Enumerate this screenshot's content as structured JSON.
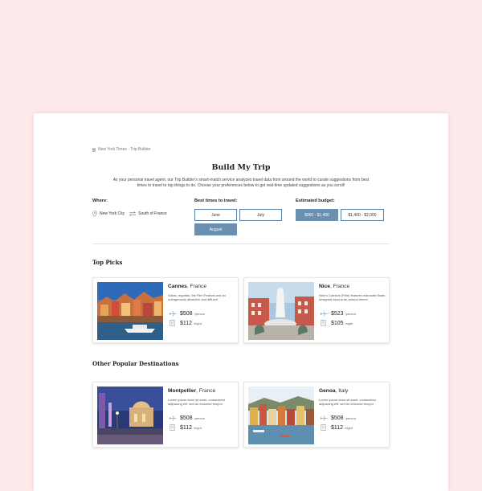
{
  "breadcrumb": "New York Times - Trip Builder",
  "title": "Build My Trip",
  "intro": "As your personal travel agent, our Trip Builder's smart-match service analyzes travel data from around the world to curate suggestions from best times to travel to top things to do. Choose your preferences below to get real-time updated suggestions as you scroll!",
  "where": {
    "label": "Where:",
    "from": "New York City",
    "to": "South of France"
  },
  "times": {
    "label": "Best times to travel:",
    "options": [
      "June",
      "July",
      "August"
    ],
    "selected": "August"
  },
  "budget": {
    "label": "Estimated budget:",
    "options": [
      "$960 - $1,400",
      "$1,400 - $2,000"
    ],
    "selected": "$960 - $1,400"
  },
  "top_picks": {
    "heading": "Top Picks",
    "items": [
      {
        "city": "Cannes",
        "country": ", France",
        "desc": "Galas, regattas, the Film Festival and an outrageously attractive and affluent",
        "flight": "$508",
        "flight_unit": "/person",
        "hotel": "$112",
        "hotel_unit": "/night"
      },
      {
        "city": "Nice",
        "country": ", France",
        "desc": "Nice's Carnival (Fête) features elaborate floats designed around an annual theme.",
        "flight": "$523",
        "flight_unit": "/person",
        "hotel": "$105",
        "hotel_unit": "/night"
      }
    ]
  },
  "other": {
    "heading": "Other Popular Destinations",
    "items": [
      {
        "city": "Montpellier",
        "country": ", France",
        "desc": "Lorem ipsum dolor sit amet, consectetur adipiscing elit, sed do eiusmod tempor",
        "flight": "$508",
        "flight_unit": "/person",
        "hotel": "$112",
        "hotel_unit": "/night"
      },
      {
        "city": "Genoa",
        "country": ", Italy",
        "desc": "Lorem ipsum dolor sit amet, consectetur adipiscing elit, sed do eiusmod tempor",
        "flight": "$508",
        "flight_unit": "/person",
        "hotel": "$112",
        "hotel_unit": "/night"
      }
    ]
  },
  "colors": {
    "background": "#fde9ea",
    "accent": "#6b8fae"
  }
}
